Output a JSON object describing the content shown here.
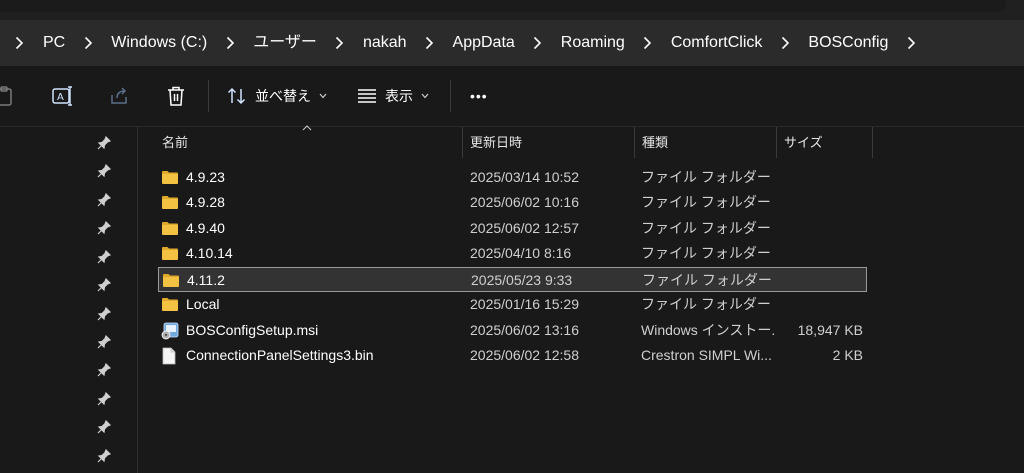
{
  "breadcrumb": [
    "PC",
    "Windows (C:)",
    "ユーザー",
    "nakah",
    "AppData",
    "Roaming",
    "ComfortClick",
    "BOSConfig"
  ],
  "toolbar": {
    "sort_label": "並べ替え",
    "view_label": "表示",
    "more_label": "•••"
  },
  "columns": {
    "name": "名前",
    "modified": "更新日時",
    "type": "種類",
    "size": "サイズ"
  },
  "files": [
    {
      "name": "4.9.23",
      "modified": "2025/03/14 10:52",
      "type": "ファイル フォルダー",
      "size": "",
      "icon": "folder-icon"
    },
    {
      "name": "4.9.28",
      "modified": "2025/06/02 10:16",
      "type": "ファイル フォルダー",
      "size": "",
      "icon": "folder-icon"
    },
    {
      "name": "4.9.40",
      "modified": "2025/06/02 12:57",
      "type": "ファイル フォルダー",
      "size": "",
      "icon": "folder-icon"
    },
    {
      "name": "4.10.14",
      "modified": "2025/04/10 8:16",
      "type": "ファイル フォルダー",
      "size": "",
      "icon": "folder-icon"
    },
    {
      "name": "4.11.2",
      "modified": "2025/05/23 9:33",
      "type": "ファイル フォルダー",
      "size": "",
      "icon": "folder-icon",
      "selected": true
    },
    {
      "name": "Local",
      "modified": "2025/01/16 15:29",
      "type": "ファイル フォルダー",
      "size": "",
      "icon": "folder-icon"
    },
    {
      "name": "BOSConfigSetup.msi",
      "modified": "2025/06/02 13:16",
      "type": "Windows インストー...",
      "size": "18,947 KB",
      "icon": "msi-installer-icon"
    },
    {
      "name": "ConnectionPanelSettings3.bin",
      "modified": "2025/06/02 12:58",
      "type": "Crestron SIMPL Wi...",
      "size": "2 KB",
      "icon": "file-icon"
    }
  ],
  "colors": {
    "accent_folder": "#f4c242",
    "background": "#191919",
    "address_bar": "#2b2b2b",
    "selection": "#333333"
  }
}
